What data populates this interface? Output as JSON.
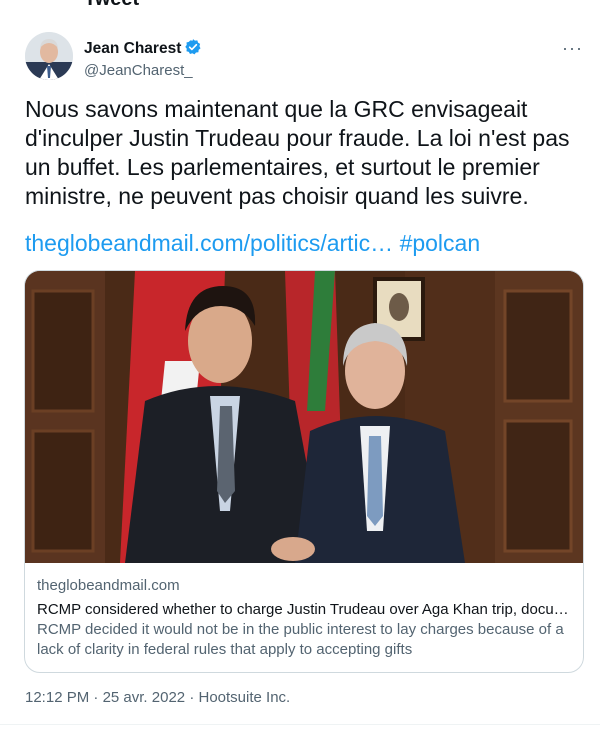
{
  "header": {
    "cut_text": "Tweet",
    "display_name": "Jean Charest",
    "handle": "@JeanCharest_",
    "more_label": "···"
  },
  "tweet": {
    "text": "Nous savons maintenant que la GRC envisageait\nd'inculper Justin Trudeau pour fraude. La loi n'est pas\nun buffet. Les parlementaires, et surtout le premier\nministre, ne peuvent pas choisir quand les suivre.",
    "link": "theglobeandmail.com/politics/artic…",
    "hashtag": "#polcan"
  },
  "card": {
    "domain": "theglobeandmail.com",
    "title": "RCMP considered whether to charge Justin Trudeau over Aga Khan trip, docu…",
    "description": "RCMP decided it would not be in the public interest to lay charges because of a lack of clarity in federal rules that apply to accepting gifts"
  },
  "meta": {
    "time": "12:12 PM",
    "separator": "·",
    "date": "25 avr. 2022",
    "source": "Hootsuite Inc."
  },
  "colors": {
    "link": "#1d9bf0",
    "secondary_text": "#536471",
    "verified": "#1d9bf0"
  }
}
